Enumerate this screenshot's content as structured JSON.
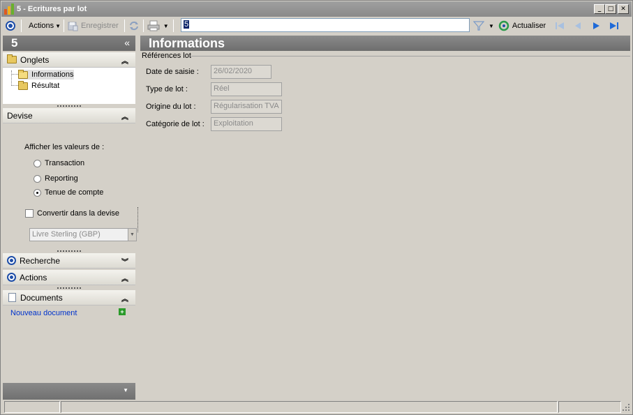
{
  "window": {
    "title": "5 -  Ecritures par lot",
    "controls": {
      "minimize": "_",
      "maximize": "□",
      "close": "✕"
    }
  },
  "toolbar": {
    "actions_label": "Actions",
    "save_label": "Enregistrer",
    "search_value": "5",
    "refresh_label": "Actualiser"
  },
  "sidebar": {
    "header": "5",
    "collapse_glyph": "«",
    "tabs_section": {
      "title": "Onglets",
      "items": [
        {
          "label": "Informations",
          "selected": true
        },
        {
          "label": "Résultat",
          "selected": false
        }
      ]
    },
    "currency_section": {
      "title": "Devise",
      "show_values_label": "Afficher les valeurs de :",
      "options": [
        {
          "label": "Transaction",
          "checked": false
        },
        {
          "label": "Reporting",
          "checked": false
        },
        {
          "label": "Tenue de compte",
          "checked": true
        }
      ],
      "convert_label": "Convertir dans la devise",
      "convert_checked": false,
      "currency_value": "Livre Sterling (GBP)"
    },
    "search_section": {
      "title": "Recherche"
    },
    "actions_section": {
      "title": "Actions"
    },
    "documents_section": {
      "title": "Documents",
      "new_document": "Nouveau document"
    }
  },
  "main": {
    "title": "Informations",
    "group_title": "Références lot",
    "fields": [
      {
        "label": "Date de saisie :",
        "value": "26/02/2020"
      },
      {
        "label": "Type de lot :",
        "value": "Réel"
      },
      {
        "label": "Origine du lot :",
        "value": "Régularisation TVA"
      },
      {
        "label": "Catégorie de lot :",
        "value": "Exploitation"
      }
    ]
  },
  "colors": {
    "accent_blue": "#1e4ea8",
    "link_blue": "#0033cc",
    "panel_header_gray": "#808080"
  },
  "icons": [
    "app-icon",
    "circle-target-icon",
    "save-icon",
    "refresh-icon",
    "print-icon",
    "filter-icon",
    "refresh-green-icon",
    "first-icon",
    "prev-icon",
    "next-icon",
    "last-icon",
    "folder-icon",
    "document-icon",
    "add-icon"
  ]
}
